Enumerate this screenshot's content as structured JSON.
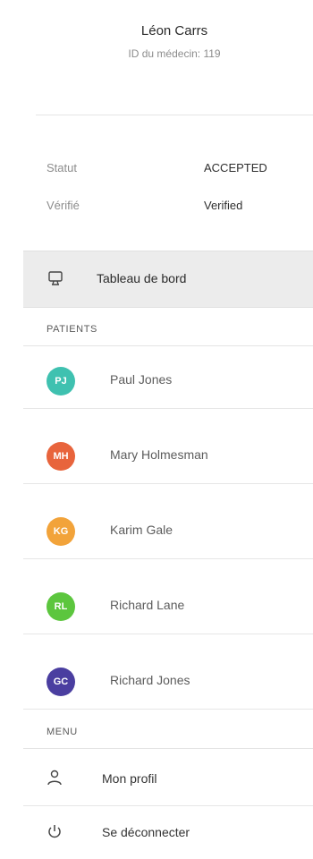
{
  "profile": {
    "name": "Léon Carrs",
    "doctor_id": "ID du médecin: 119"
  },
  "info": [
    {
      "key": "Statut",
      "value": "ACCEPTED"
    },
    {
      "key": "Vérifié",
      "value": "Verified"
    }
  ],
  "dashboard": {
    "label": "Tableau de bord",
    "icon": "monitor-icon"
  },
  "patients_title": "PATIENTS",
  "patients": [
    {
      "initials": "PJ",
      "name": "Paul Jones",
      "color": "#3fc1b0"
    },
    {
      "initials": "MH",
      "name": "Mary Holmesman",
      "color": "#e8643c"
    },
    {
      "initials": "KG",
      "name": "Karim Gale",
      "color": "#f2a33a"
    },
    {
      "initials": "RL",
      "name": "Richard Lane",
      "color": "#5cc63e"
    },
    {
      "initials": "GC",
      "name": "Richard Jones",
      "color": "#4a3ea0"
    }
  ],
  "menu_title": "MENU",
  "menu": [
    {
      "label": "Mon profil",
      "icon": "user-icon"
    },
    {
      "label": "Se déconnecter",
      "icon": "power-icon"
    }
  ]
}
